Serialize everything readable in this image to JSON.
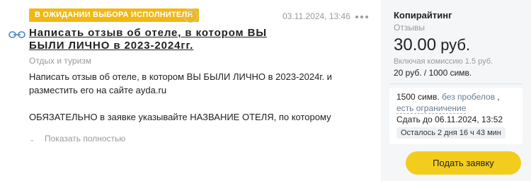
{
  "task": {
    "status_badge": "В ОЖИДАНИИ ВЫБОРА ИСПОЛНИТЕЛЯ",
    "help_symbol": "?",
    "date": "03.11.2024, 13:46",
    "title": "Написать отзыв об отеле, в котором ВЫ БЫЛИ ЛИЧНО в 2023-2024гг.",
    "category": "Отдых и туризм",
    "description_line1": "Написать отзыв об отеле, в котором ВЫ БЫЛИ ЛИЧНО в 2023-2024г. и разместить его на сайте ayda.ru",
    "description_line2": "ОБЯЗАТЕЛЬНО в заявке указывайте НАЗВАНИЕ ОТЕЛЯ, по которому",
    "show_more": "Показать полностью",
    "icons": {
      "link": "link-icon",
      "more": "more-dots-icon",
      "expand": "chevron-down-icon"
    }
  },
  "side": {
    "category": "Копирайтинг",
    "subcategory": "Отзывы",
    "price": "30.00",
    "currency": "руб.",
    "commission": "Включая комиссию 1.5 руб.",
    "rate": "20 руб. / 1000 симв.",
    "chars": "1500 симв.",
    "no_spaces": "без пробелов",
    "comma": ",",
    "limit": "есть ограничение",
    "deadline": "Сдать до 06.11.2024, 13:52",
    "remaining": "Осталось 2 дня 16 ч 43 мин",
    "submit_label": "Подать заявку"
  },
  "colors": {
    "badge": "#f2b812",
    "button": "#f2cd1d",
    "panel": "#f4f6f8"
  }
}
